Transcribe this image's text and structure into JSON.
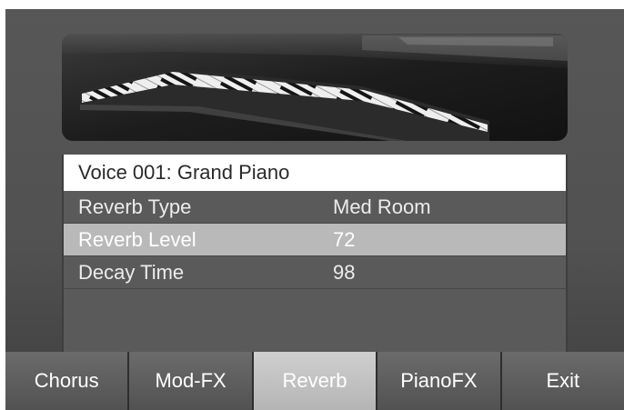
{
  "voice": {
    "title": "Voice 001: Grand Piano"
  },
  "params": [
    {
      "label": "Reverb Type",
      "value": "Med Room",
      "selected": false
    },
    {
      "label": "Reverb Level",
      "value": "72",
      "selected": true
    },
    {
      "label": "Decay Time",
      "value": "98",
      "selected": false
    }
  ],
  "tabs": [
    {
      "label": "Chorus",
      "active": false
    },
    {
      "label": "Mod-FX",
      "active": false
    },
    {
      "label": "Reverb",
      "active": true
    },
    {
      "label": "PianoFX",
      "active": false
    },
    {
      "label": "Exit",
      "active": false
    }
  ],
  "colors": {
    "background": "#555555",
    "selected_row": "#b9b9b9",
    "active_tab": "#c4c4c4",
    "title_row": "#ffffff"
  }
}
